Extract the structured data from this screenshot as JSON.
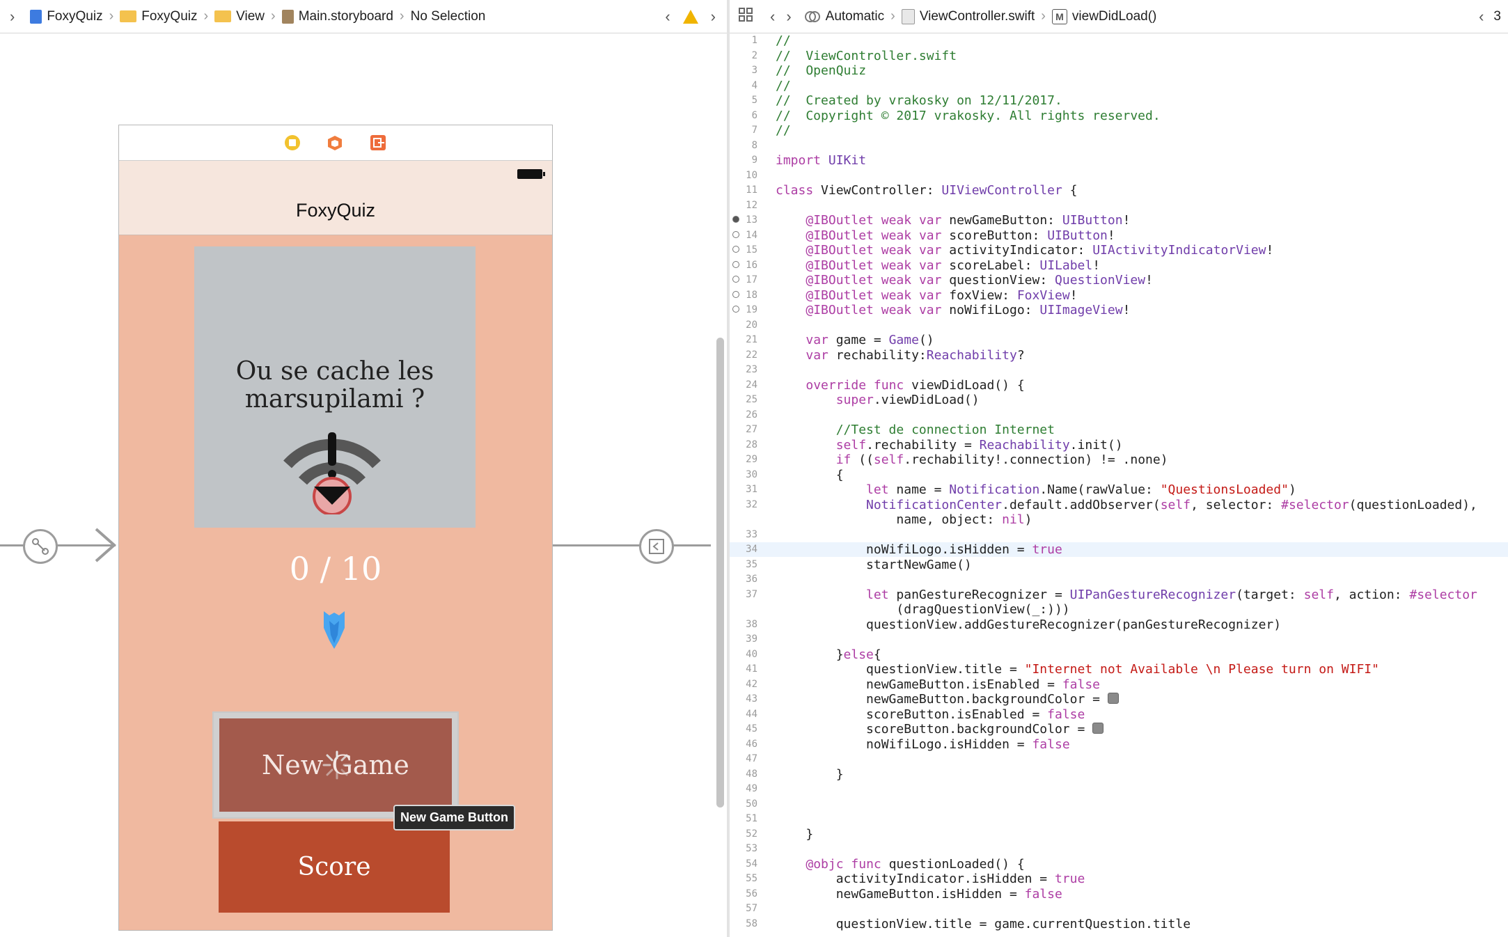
{
  "storyboard_bar": {
    "crumbs": [
      "FoxyQuiz",
      "FoxyQuiz",
      "View",
      "Main.storyboard",
      "No Selection"
    ]
  },
  "editor_bar": {
    "mode": "Automatic",
    "file": "ViewController.swift",
    "method": "viewDidLoad()",
    "counter": "3"
  },
  "scene": {
    "nav_title": "FoxyQuiz",
    "question_title": "Ou se cache les marsupilami ?",
    "score_label": "0 / 10",
    "new_game_label": "New Game",
    "score_button_label": "Score",
    "tooltip": "New Game Button"
  },
  "code_lines": [
    {
      "n": "1",
      "t": "//"
    },
    {
      "n": "2",
      "t": "//  ViewController.swift"
    },
    {
      "n": "3",
      "t": "//  OpenQuiz"
    },
    {
      "n": "4",
      "t": "//"
    },
    {
      "n": "5",
      "t": "//  Created by vrakosky on 12/11/2017."
    },
    {
      "n": "6",
      "t": "//  Copyright © 2017 vrakosky. All rights reserved."
    },
    {
      "n": "7",
      "t": "//"
    },
    {
      "n": "8",
      "t": ""
    },
    {
      "n": "9",
      "t": "import UIKit"
    },
    {
      "n": "10",
      "t": ""
    },
    {
      "n": "11",
      "t": "class ViewController: UIViewController {"
    },
    {
      "n": "12",
      "t": ""
    },
    {
      "n": "13",
      "t": "    @IBOutlet weak var newGameButton: UIButton!",
      "marker": "filled"
    },
    {
      "n": "14",
      "t": "    @IBOutlet weak var scoreButton: UIButton!",
      "marker": "ring"
    },
    {
      "n": "15",
      "t": "    @IBOutlet weak var activityIndicator: UIActivityIndicatorView!",
      "marker": "ring"
    },
    {
      "n": "16",
      "t": "    @IBOutlet weak var scoreLabel: UILabel!",
      "marker": "ring"
    },
    {
      "n": "17",
      "t": "    @IBOutlet weak var questionView: QuestionView!",
      "marker": "ring"
    },
    {
      "n": "18",
      "t": "    @IBOutlet weak var foxView: FoxView!",
      "marker": "ring"
    },
    {
      "n": "19",
      "t": "    @IBOutlet weak var noWifiLogo: UIImageView!",
      "marker": "ring"
    },
    {
      "n": "20",
      "t": ""
    },
    {
      "n": "21",
      "t": "    var game = Game()"
    },
    {
      "n": "22",
      "t": "    var rechability:Reachability?"
    },
    {
      "n": "23",
      "t": ""
    },
    {
      "n": "24",
      "t": "    override func viewDidLoad() {"
    },
    {
      "n": "25",
      "t": "        super.viewDidLoad()"
    },
    {
      "n": "26",
      "t": ""
    },
    {
      "n": "27",
      "t": "        //Test de connection Internet"
    },
    {
      "n": "28",
      "t": "        self.rechability = Reachability.init()"
    },
    {
      "n": "29",
      "t": "        if ((self.rechability!.connection) != .none)"
    },
    {
      "n": "30",
      "t": "        {"
    },
    {
      "n": "31",
      "t": "            let name = Notification.Name(rawValue: \"QuestionsLoaded\")"
    },
    {
      "n": "32",
      "t": "            NotificationCenter.default.addObserver(self, selector: #selector(questionLoaded),"
    },
    {
      "n": "",
      "t": "                name, object: nil)"
    },
    {
      "n": "33",
      "t": ""
    },
    {
      "n": "34",
      "t": "            noWifiLogo.isHidden = true",
      "current": true
    },
    {
      "n": "35",
      "t": "            startNewGame()"
    },
    {
      "n": "36",
      "t": ""
    },
    {
      "n": "37",
      "t": "            let panGestureRecognizer = UIPanGestureRecognizer(target: self, action: #selector"
    },
    {
      "n": "",
      "t": "                (dragQuestionView(_:)))"
    },
    {
      "n": "38",
      "t": "            questionView.addGestureRecognizer(panGestureRecognizer)"
    },
    {
      "n": "39",
      "t": ""
    },
    {
      "n": "40",
      "t": "        }else{"
    },
    {
      "n": "41",
      "t": "            questionView.title = \"Internet not Available \\n Please turn on WIFI\""
    },
    {
      "n": "42",
      "t": "            newGameButton.isEnabled = false"
    },
    {
      "n": "43",
      "t": "            newGameButton.backgroundColor = ",
      "swatch": true
    },
    {
      "n": "44",
      "t": "            scoreButton.isEnabled = false"
    },
    {
      "n": "45",
      "t": "            scoreButton.backgroundColor = ",
      "swatch": true
    },
    {
      "n": "46",
      "t": "            noWifiLogo.isHidden = false"
    },
    {
      "n": "47",
      "t": ""
    },
    {
      "n": "48",
      "t": "        }"
    },
    {
      "n": "49",
      "t": ""
    },
    {
      "n": "50",
      "t": ""
    },
    {
      "n": "51",
      "t": ""
    },
    {
      "n": "52",
      "t": "    }"
    },
    {
      "n": "53",
      "t": ""
    },
    {
      "n": "54",
      "t": "    @objc func questionLoaded() {"
    },
    {
      "n": "55",
      "t": "        activityIndicator.isHidden = true"
    },
    {
      "n": "56",
      "t": "        newGameButton.isHidden = false"
    },
    {
      "n": "57",
      "t": ""
    },
    {
      "n": "58",
      "t": "        questionView.title = game.currentQuestion.title"
    }
  ],
  "colors": {
    "scene_bg": "#f0b9a0",
    "nav_bg": "#f6e6dd",
    "question_bg": "#c0c4c7",
    "new_game_bg": "#a35a4c",
    "score_bg": "#b94b2d",
    "keyword": "#ad3da4",
    "comment": "#2e7d32",
    "type": "#703daa",
    "string": "#c41a16"
  },
  "icons": [
    "chevron-right-icon",
    "storyboard-file-icon",
    "folder-icon",
    "warning-icon",
    "related-items-icon",
    "assistant-icon",
    "swift-file-icon",
    "method-icon",
    "view-controller-icon",
    "first-responder-icon",
    "exit-icon",
    "no-wifi-icon",
    "fox-icon",
    "activity-indicator-icon",
    "segue-icon"
  ]
}
